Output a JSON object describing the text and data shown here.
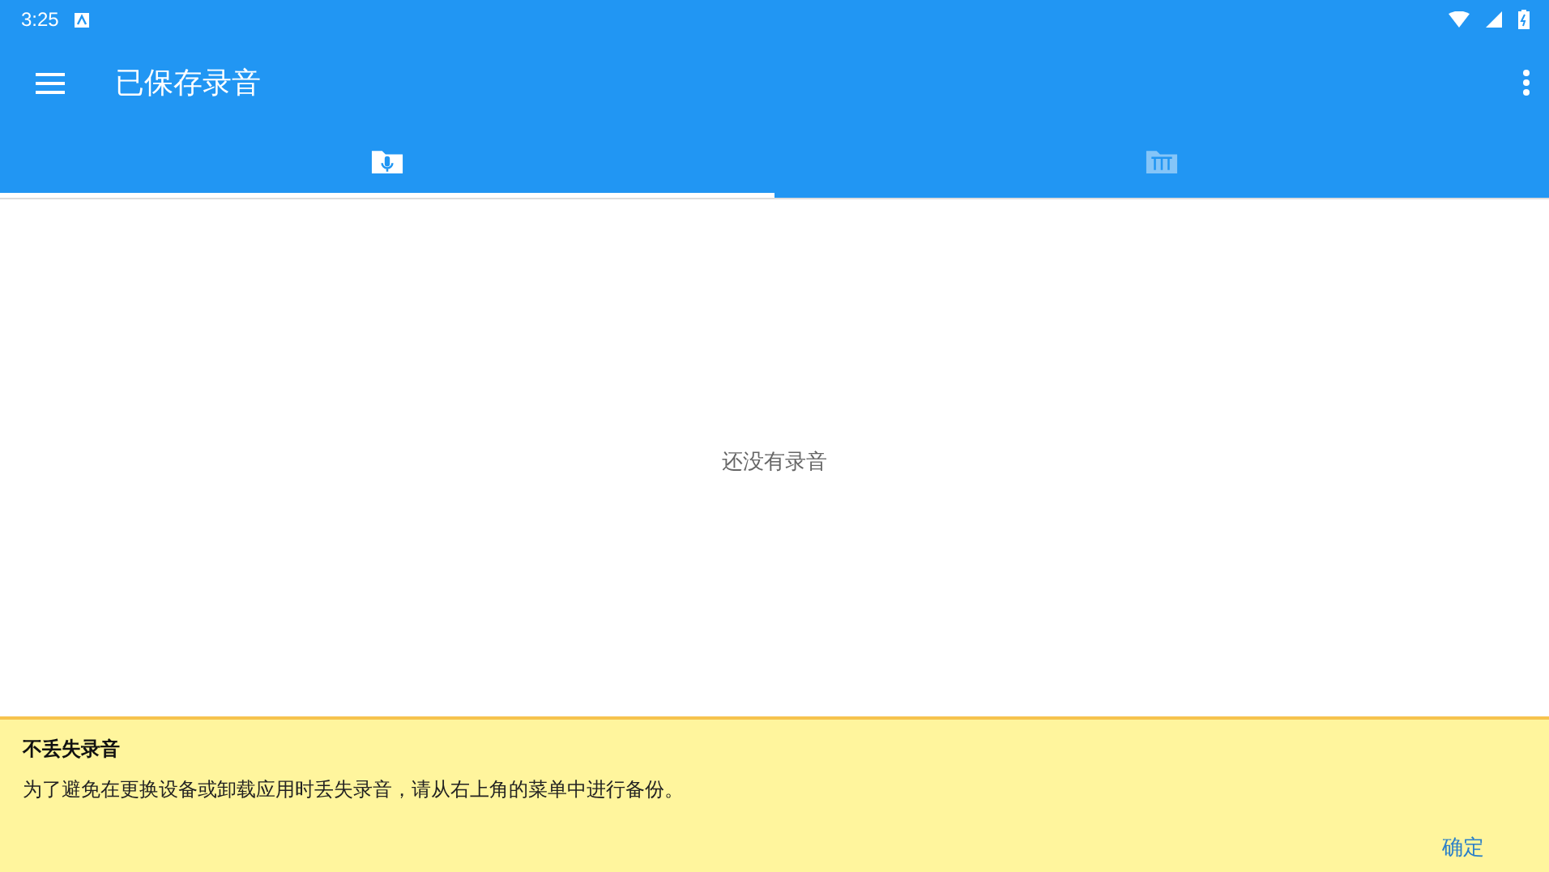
{
  "status_bar": {
    "time": "3:25"
  },
  "toolbar": {
    "title": "已保存录音"
  },
  "tabs": [
    {
      "kind": "recordings",
      "selected": true
    },
    {
      "kind": "instruments",
      "selected": false
    }
  ],
  "empty_message": "还没有录音",
  "banner": {
    "title": "不丢失录音",
    "message": "为了避免在更换设备或卸载应用时丢失录音，请从右上角的菜单中进行备份。",
    "action": "确定"
  }
}
